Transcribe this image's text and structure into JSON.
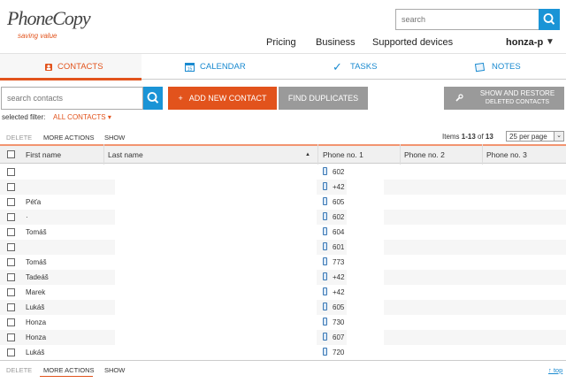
{
  "brand": {
    "name": "PhoneCopy",
    "tagline": "saving value"
  },
  "top_search": {
    "placeholder": "search"
  },
  "nav": {
    "pricing": "Pricing",
    "business": "Business",
    "supported": "Supported devices",
    "user": "honza-p",
    "caret": "▼"
  },
  "tabs": [
    {
      "label": "CONTACTS"
    },
    {
      "label": "CALENDAR"
    },
    {
      "label": "TASKS"
    },
    {
      "label": "NOTES"
    }
  ],
  "toolbar": {
    "search_placeholder": "search contacts",
    "add_label": "ADD NEW CONTACT",
    "add_prefix": "+",
    "dup_label": "FIND DUPLICATES",
    "restore_line1": "SHOW AND RESTORE",
    "restore_line2": "DELETED CONTACTS"
  },
  "filter": {
    "label": "selected filter:",
    "value": "ALL CONTACTS",
    "caret": "▾"
  },
  "actions": {
    "delete": "DELETE",
    "more": "MORE ACTIONS",
    "show": "SHOW"
  },
  "pagination": {
    "prefix": "Items ",
    "range": "1-13",
    "of": " of ",
    "total": "13",
    "per_page": "25 per page"
  },
  "columns": {
    "first": "First name",
    "last": "Last name",
    "sort": "▲",
    "phone1": "Phone no. 1",
    "phone2": "Phone no. 2",
    "phone3": "Phone no. 3"
  },
  "rows": [
    {
      "first": "",
      "phone": "602"
    },
    {
      "first": "",
      "phone": "+42"
    },
    {
      "first": "Péťa",
      "phone": "605"
    },
    {
      "first": "·",
      "phone": "602"
    },
    {
      "first": "Tomáš",
      "phone": "604"
    },
    {
      "first": "",
      "phone": "601"
    },
    {
      "first": "Tomáš",
      "phone": "773"
    },
    {
      "first": "Tadeáš",
      "phone": "+42"
    },
    {
      "first": "Marek",
      "phone": "+42"
    },
    {
      "first": "Lukáš",
      "phone": "605"
    },
    {
      "first": "Honza",
      "phone": "730"
    },
    {
      "first": "Honza",
      "phone": "607"
    },
    {
      "first": "Lukáš",
      "phone": "720"
    }
  ],
  "footer": {
    "to_top": "↑ top"
  },
  "colors": {
    "accent": "#e2531c",
    "blue": "#1a94d6",
    "grey_button": "#9a9a9a"
  }
}
